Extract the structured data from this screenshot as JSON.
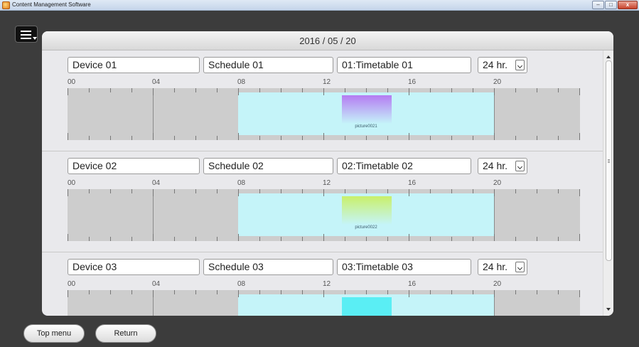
{
  "window": {
    "title": "Content Management Software"
  },
  "header": {
    "date": "2016 / 05 / 20"
  },
  "hour_labels": [
    "00",
    "04",
    "08",
    "12",
    "16",
    "20"
  ],
  "devices": [
    {
      "device": "Device 01",
      "schedule": "Schedule 01",
      "timetable": "01:Timetable 01",
      "hours": "24 hr.",
      "content_label": "picture0021",
      "content_color_top": "#b47cf2",
      "content_color_bottom": "#c5f4f9"
    },
    {
      "device": "Device 02",
      "schedule": "Schedule 02",
      "timetable": "02:Timetable 02",
      "hours": "24 hr.",
      "content_label": "picture0022",
      "content_color_top": "#c9f06a",
      "content_color_bottom": "#c5f4f9"
    },
    {
      "device": "Device 03",
      "schedule": "Schedule 03",
      "timetable": "03:Timetable 03",
      "hours": "24 hr.",
      "content_label": "",
      "content_color_top": "#5aeef4",
      "content_color_bottom": "#5aeef4"
    }
  ],
  "footer": {
    "top_menu_label": "Top menu",
    "return_label": "Return"
  },
  "icons": {
    "menu": "hamburger-menu-icon"
  }
}
